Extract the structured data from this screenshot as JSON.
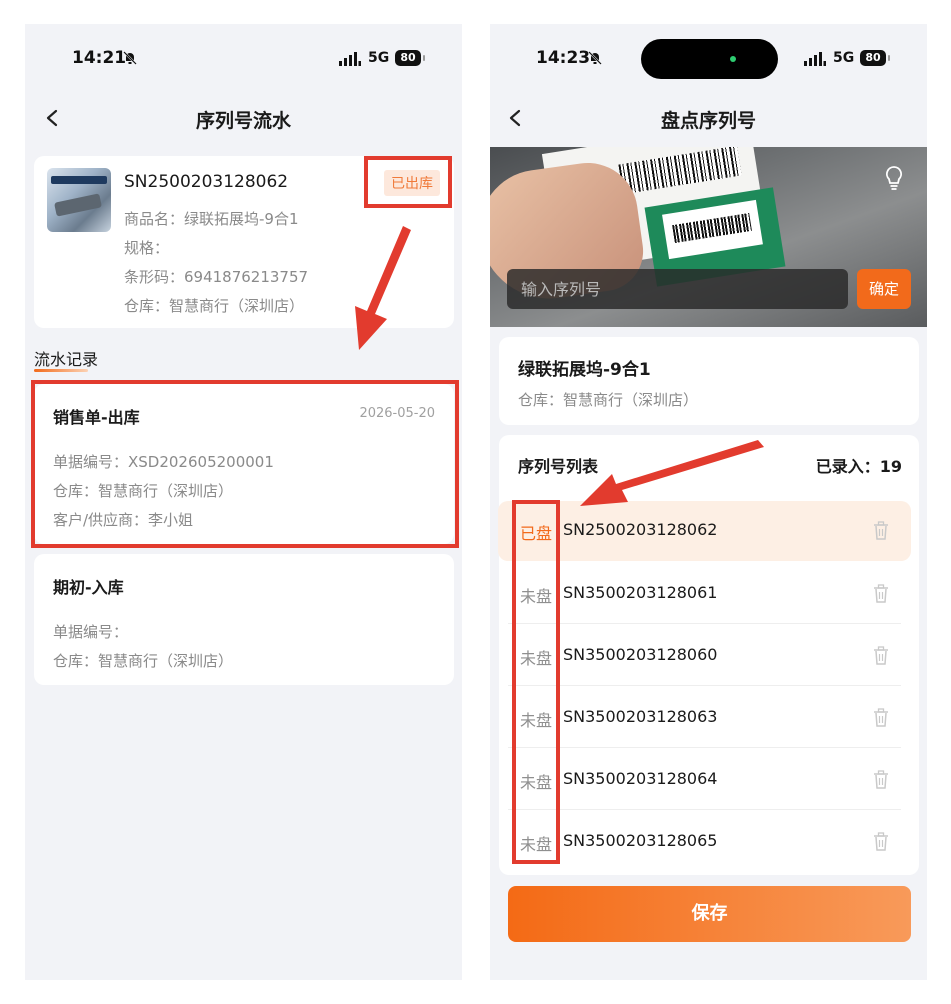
{
  "left_screen": {
    "status": {
      "time": "14:21",
      "network": "5G",
      "battery": "80"
    },
    "nav": {
      "title": "序列号流水"
    },
    "product": {
      "sn": "SN2500203128062",
      "tag": "已出库",
      "name_line": "商品名：绿联拓展坞-9合1",
      "spec_line": "规格：",
      "barcode_line": "条形码：6941876213757",
      "warehouse_line": "仓库：智慧商行（深圳店）"
    },
    "section_title": "流水记录",
    "records": [
      {
        "title": "销售单-出库",
        "date": "2026-05-20",
        "lines": [
          "单据编号：XSD202605200001",
          "仓库：智慧商行（深圳店）",
          "客户/供应商：李小姐"
        ]
      },
      {
        "title": "期初-入库",
        "date": "",
        "lines": [
          "单据编号：",
          "仓库：智慧商行（深圳店）"
        ]
      }
    ]
  },
  "right_screen": {
    "status": {
      "time": "14:23",
      "network": "5G",
      "battery": "80"
    },
    "nav": {
      "title": "盘点序列号"
    },
    "scanner": {
      "input_placeholder": "输入序列号",
      "confirm_label": "确定"
    },
    "product": {
      "name": "绿联拓展坞-9合1",
      "warehouse_line": "仓库：智慧商行（深圳店）"
    },
    "list": {
      "title": "序列号列表",
      "count_label": "已录入：19",
      "rows": [
        {
          "status": "已盘",
          "sn": "SN2500203128062"
        },
        {
          "status": "未盘",
          "sn": "SN3500203128061"
        },
        {
          "status": "未盘",
          "sn": "SN3500203128060"
        },
        {
          "status": "未盘",
          "sn": "SN3500203128063"
        },
        {
          "status": "未盘",
          "sn": "SN3500203128064"
        },
        {
          "status": "未盘",
          "sn": "SN3500203128065"
        }
      ]
    },
    "save_label": "保存"
  },
  "icons": [
    "chevron-left-icon",
    "bell-slash-icon",
    "signal-icon",
    "battery-icon",
    "bulb-icon",
    "trash-icon"
  ],
  "colors": {
    "accent": "#f26a1b",
    "annotation_red": "#e23b2e",
    "background": "#f2f3f7"
  }
}
